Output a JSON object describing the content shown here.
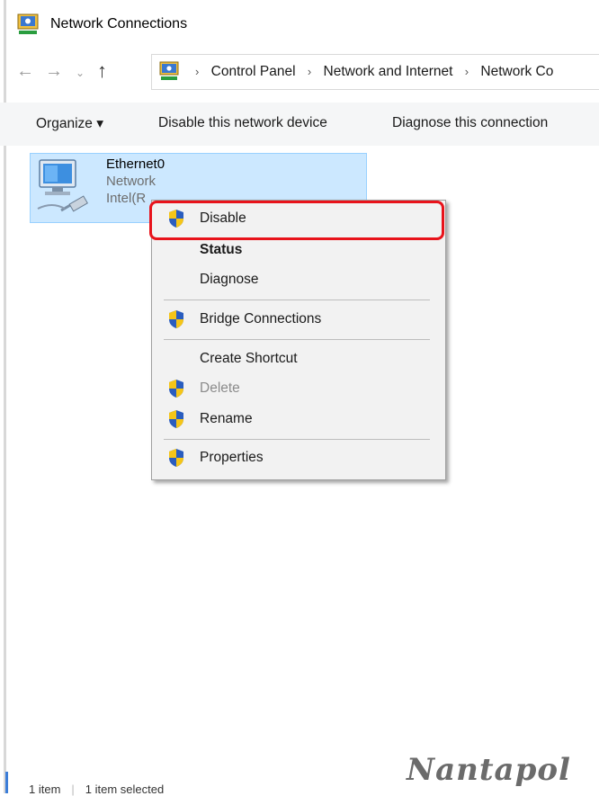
{
  "window": {
    "title": "Network Connections",
    "icon": "network-connections-icon"
  },
  "nav": {
    "back": "←",
    "forward": "→",
    "recent": "⌄",
    "up": "↑",
    "breadcrumb": [
      "Control Panel",
      "Network and Internet",
      "Network Co"
    ],
    "separator": "›"
  },
  "toolbar": {
    "organize": "Organize ▾",
    "disable_device": "Disable this network device",
    "diagnose_connection": "Diagnose this connection"
  },
  "item": {
    "name": "Ethernet0",
    "status": "Network",
    "adapter": "Intel(R"
  },
  "context_menu": {
    "disable": "Disable",
    "status": "Status",
    "diagnose": "Diagnose",
    "bridge": "Bridge Connections",
    "create_shortcut": "Create Shortcut",
    "delete": "Delete",
    "rename": "Rename",
    "properties": "Properties"
  },
  "statusbar": {
    "items": "1 item",
    "selected": "1 item selected"
  },
  "watermark": "Nantapol",
  "colors": {
    "highlight": "#e8131b",
    "selection": "#cce8ff",
    "menu_bg": "#f2f2f2",
    "shield_blue": "#2a5dbf",
    "shield_yellow": "#f5c518"
  }
}
